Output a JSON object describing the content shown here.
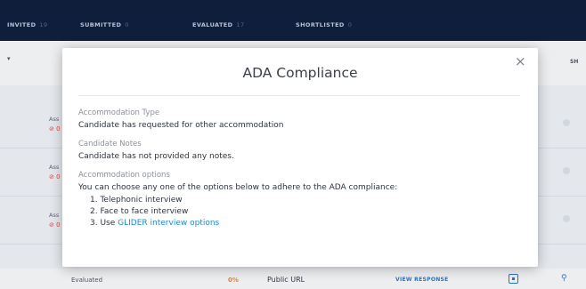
{
  "nav": {
    "tabs": [
      {
        "label": "INVITED",
        "count": "19"
      },
      {
        "label": "SUBMITTED",
        "count": "0"
      },
      {
        "label": "EVALUATED",
        "count": "17"
      },
      {
        "label": "SHORTLISTED",
        "count": "0"
      }
    ]
  },
  "toolbar": {
    "sh_label": "SH"
  },
  "rows": [
    {
      "label": "Ass",
      "status": "⊘ 0"
    },
    {
      "label": "Ass",
      "status": "⊘ 0"
    },
    {
      "label": "Ass",
      "status": "⊘ 0"
    }
  ],
  "bottom_row": {
    "status": "Evaluated",
    "score": "0%",
    "source": "Public URL",
    "action": "VIEW RESPONSE"
  },
  "modal": {
    "title": "ADA Compliance",
    "close_symbol": "×",
    "accommodation_type_label": "Accommodation Type",
    "accommodation_type_value": "Candidate has requested for other accommodation",
    "notes_label": "Candidate Notes",
    "notes_value": "Candidate has not provided any notes.",
    "options_label": "Accommodation options",
    "options_intro": "You can choose any one of the options below to adhere to the ADA compliance:",
    "options": [
      {
        "num": "1.",
        "text": "Telephonic interview"
      },
      {
        "num": "2.",
        "text": "Face to face interview"
      },
      {
        "num": "3.",
        "prefix": "Use ",
        "link": "GLIDER interview options"
      }
    ]
  }
}
